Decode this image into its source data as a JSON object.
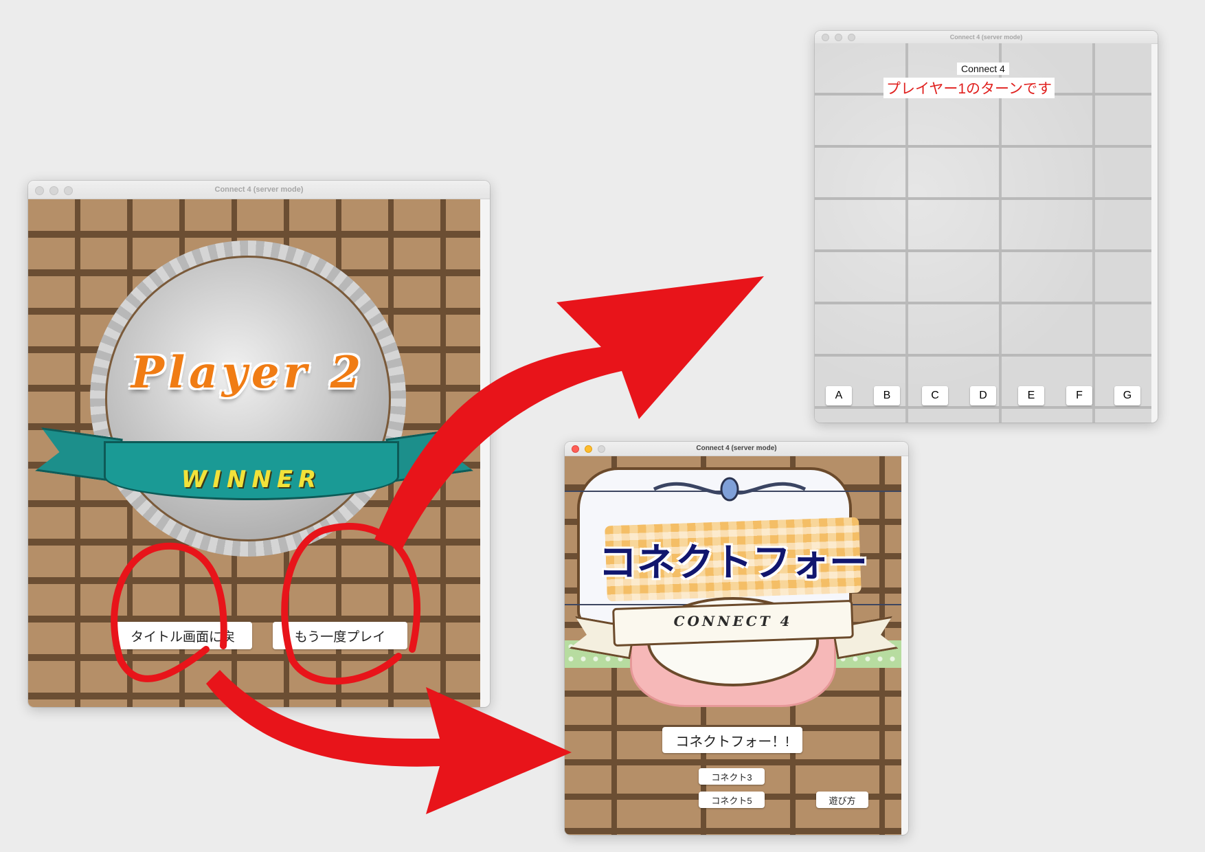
{
  "windows": {
    "winner": {
      "title": "Connect 4 (server mode)",
      "player_label": "Player 2",
      "winner_label": "WINNER",
      "buttons": {
        "title_screen": "タイトル画面に戻",
        "play_again": "もう一度プレイ"
      }
    },
    "game": {
      "title": "Connect 4 (server mode)",
      "heading": "Connect 4",
      "turn_message": "プレイヤー1のターンです",
      "columns": [
        "A",
        "B",
        "C",
        "D",
        "E",
        "F",
        "G"
      ]
    },
    "title_screen": {
      "title": "Connect 4 (server mode)",
      "logo_jp": "コネクトフォー",
      "logo_en": "CONNECT 4",
      "buttons": {
        "connect4": "コネクトフォー！!",
        "connect3": "コネクト3",
        "connect5": "コネクト5",
        "how_to_play": "遊び方"
      }
    }
  },
  "colors": {
    "annotation_red": "#e8141a",
    "turn_text": "#e0201e",
    "ribbon_teal": "#1a9a95",
    "winner_yellow": "#f2e23a",
    "player_orange": "#f07c14",
    "logo_navy": "#11166e"
  },
  "icons": {
    "window_controls": [
      "close-light",
      "minimize-light",
      "zoom-light"
    ]
  }
}
